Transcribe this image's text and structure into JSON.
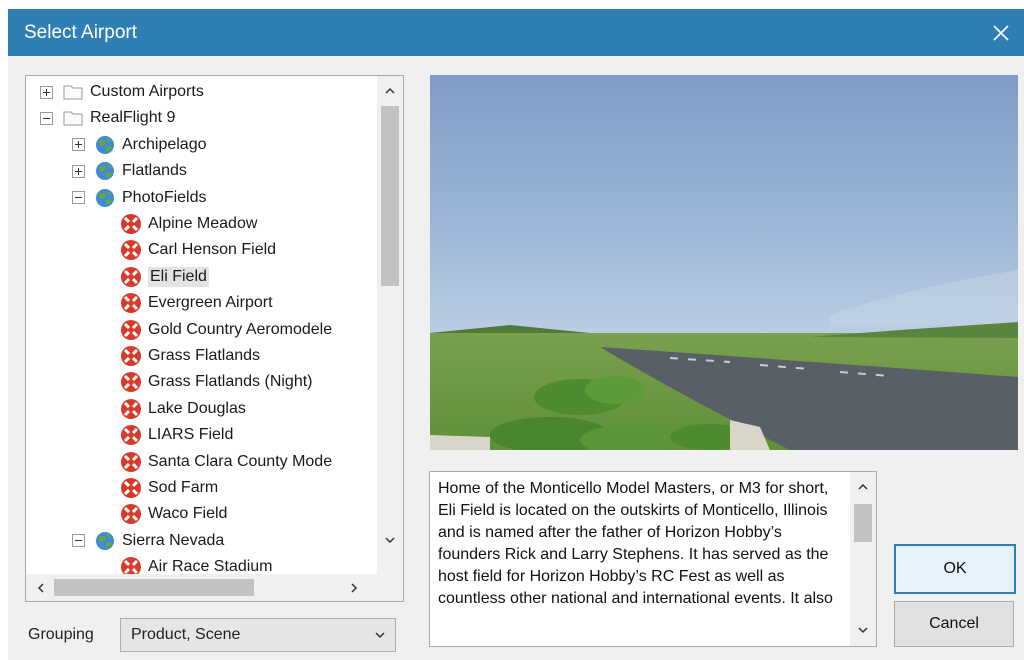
{
  "window": {
    "title": "Select Airport"
  },
  "tree": {
    "items": [
      {
        "label": "Custom Airports",
        "expander": "plus",
        "icon": "folder-icon"
      },
      {
        "label": "RealFlight 9",
        "expander": "minus",
        "icon": "folder-icon"
      },
      {
        "label": "Archipelago",
        "expander": "plus",
        "icon": "globe-icon"
      },
      {
        "label": "Flatlands",
        "expander": "plus",
        "icon": "globe-icon"
      },
      {
        "label": "PhotoFields",
        "expander": "minus",
        "icon": "globe-icon"
      },
      {
        "label": "Alpine Meadow",
        "icon": "airport-icon"
      },
      {
        "label": "Carl Henson Field",
        "icon": "airport-icon"
      },
      {
        "label": "Eli Field",
        "icon": "airport-icon",
        "selected": true
      },
      {
        "label": "Evergreen Airport",
        "icon": "airport-icon"
      },
      {
        "label": "Gold Country Aeromodele",
        "icon": "airport-icon"
      },
      {
        "label": "Grass Flatlands",
        "icon": "airport-icon"
      },
      {
        "label": "Grass Flatlands (Night)",
        "icon": "airport-icon"
      },
      {
        "label": "Lake Douglas",
        "icon": "airport-icon"
      },
      {
        "label": "LIARS Field",
        "icon": "airport-icon"
      },
      {
        "label": "Santa Clara County Mode",
        "icon": "airport-icon"
      },
      {
        "label": "Sod Farm",
        "icon": "airport-icon"
      },
      {
        "label": "Waco Field",
        "icon": "airport-icon"
      },
      {
        "label": "Sierra Nevada",
        "expander": "minus",
        "icon": "globe-icon"
      },
      {
        "label": "Air Race Stadium",
        "icon": "airport-icon"
      }
    ]
  },
  "description": {
    "text": "Home of the Monticello Model Masters, or M3 for short, Eli Field is located on the outskirts of Monticello, Illinois and is named after the father of Horizon Hobby’s founders Rick and Larry Stephens.  It has served as the host field for Horizon Hobby’s RC Fest as well as countless other national and international events.  It also"
  },
  "buttons": {
    "ok": "OK",
    "cancel": "Cancel"
  },
  "grouping": {
    "label": "Grouping",
    "value": "Product, Scene"
  },
  "colors": {
    "titlebar": "#2f7fb4",
    "dialog_bg": "#f0f0f0",
    "selection": "#e3e3e3"
  }
}
